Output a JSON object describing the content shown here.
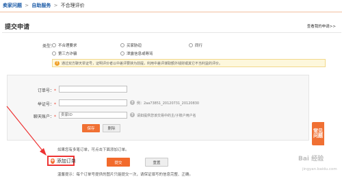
{
  "breadcrumb": {
    "items": [
      "卖家问题",
      "自助服务",
      "不合理评价"
    ],
    "separator": ">"
  },
  "panel": {
    "title": "提交申请",
    "history_link": "查看我的申请>>"
  },
  "type_group": {
    "label": "类型：",
    "options": [
      {
        "label": "不合理要求",
        "checked": false
      },
      {
        "label": "买家胁迫",
        "checked": false
      },
      {
        "label": "同行",
        "checked": false
      },
      {
        "label": "第三方诈骗",
        "checked": false
      },
      {
        "label": "泄露信息或辱骂",
        "checked": false
      }
    ]
  },
  "notice": {
    "icon": "warning-icon",
    "text": "通过双方聊天举证号，证明评价者以中差评要挟为前提，利用中差评谋取额外钱财或其它不当利益的评价。"
  },
  "form": {
    "order_no_label": "订单号：",
    "order_no_value": "",
    "evidence_label": "举证号：",
    "evidence_value": "",
    "evidence_example": "例：2aa73851_20120731_20120830",
    "chat_account_label": "聊天账户：",
    "chat_account_value": "卖家ID",
    "chat_account_hint": "请如提供您该交易中的主/子账户用户名",
    "required_mark": "*",
    "save_button": "保存",
    "delete_button": "删除"
  },
  "multi_order_hint": "如果您有多笔订单，可点击下面添加订单。",
  "add_order_button": "添加订单",
  "submit_button": "提交",
  "reset_button": "重置",
  "tip": "温馨提示：每个订单号提供的图片只能提交一次，请保证填写的信息完整、正确。",
  "faq_tab": {
    "line1": "常见",
    "line2": "问题"
  },
  "watermark": {
    "text": "Bai 经验",
    "sub": "jingyan.baidu.com"
  },
  "colors": {
    "accent": "#f07033",
    "link": "#1a5aa6",
    "highlight": "#e33333"
  }
}
